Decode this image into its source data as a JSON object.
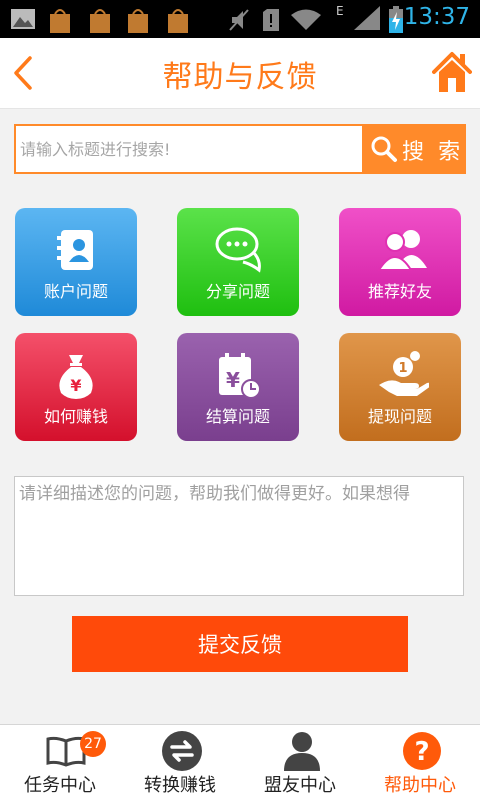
{
  "status_bar": {
    "time": "13:37"
  },
  "header": {
    "title": "帮助与反馈"
  },
  "search": {
    "placeholder": "请输入标题进行搜索!",
    "button_label": "搜 索"
  },
  "tiles": [
    {
      "label": "账户问题",
      "color": "#2b95e0",
      "icon": "contacts-book-icon"
    },
    {
      "label": "分享问题",
      "color": "#2fc71c",
      "icon": "chat-bubbles-icon"
    },
    {
      "label": "推荐好友",
      "color": "#e030b2",
      "icon": "people-icon"
    },
    {
      "label": "如何赚钱",
      "color": "#e8203c",
      "icon": "money-bag-icon"
    },
    {
      "label": "结算问题",
      "color": "#8a4f9c",
      "icon": "calendar-yen-icon"
    },
    {
      "label": "提现问题",
      "color": "#d07a2a",
      "icon": "coin-hand-icon"
    }
  ],
  "feedback": {
    "placeholder": "请详细描述您的问题，帮助我们做得更好。如果想得"
  },
  "submit_label": "提交反馈",
  "tabbar": {
    "items": [
      {
        "label": "任务中心",
        "icon": "book-icon",
        "badge": "27",
        "active": false
      },
      {
        "label": "转换赚钱",
        "icon": "exchange-icon",
        "active": false
      },
      {
        "label": "盟友中心",
        "icon": "person-icon",
        "active": false
      },
      {
        "label": "帮助中心",
        "icon": "help-icon",
        "active": true
      }
    ]
  },
  "colors": {
    "accent": "#ff7a1a",
    "submit": "#ff4a0a",
    "time": "#2fb4e8"
  }
}
